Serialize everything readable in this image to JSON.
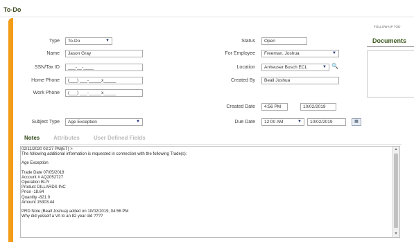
{
  "page": {
    "title": "To-Do"
  },
  "form": {
    "type": {
      "label": "Type",
      "value": "To-Do"
    },
    "name": {
      "label": "Name",
      "value": "Jason Gray"
    },
    "ssn": {
      "label": "SSN/Tax ID",
      "value": "___-__-____"
    },
    "home_phone": {
      "label": "Home Phone",
      "value": "(___) ___-_____x_____"
    },
    "work_phone": {
      "label": "Work Phone",
      "value": "(___) ___-_____x_____"
    },
    "subject_type": {
      "label": "Subject Type",
      "value": "Age Exception"
    },
    "status": {
      "label": "Status",
      "value": "Open"
    },
    "for_employee": {
      "label": "For Employee",
      "value": "Freeman, Joshua"
    },
    "location": {
      "label": "Location",
      "value": "Anheuser Busch ECL"
    },
    "created_by": {
      "label": "Created By",
      "value": "Beall Joshua"
    },
    "created_date": {
      "label": "Created Date",
      "time": "4:56 PM",
      "date": "10/02/2019"
    },
    "due_date": {
      "label": "Due Date",
      "time": "12:00 AM",
      "date": "10/02/2019"
    }
  },
  "side": {
    "followup_label": "FOLLOW-UP TOD",
    "documents_title": "Documents"
  },
  "icons": {
    "dropdown": "▼",
    "lookup": "🔍",
    "calendar": "▦",
    "scroll_up": "▲",
    "scroll_down": "▼"
  },
  "tabs": [
    {
      "label": "Notes",
      "active": true
    },
    {
      "label": "Attributes",
      "active": false
    },
    {
      "label": "User Defined Fields",
      "active": false
    }
  ],
  "notes": {
    "lines": [
      "02/11/2020 03:27 PM(ET) >",
      "The following additional information is requested in connection with the following Trade(s):",
      "",
      "Age Exception",
      "",
      "Trade Date 07/05/2018",
      "Account #   AQ2052727",
      "Operation   BUY",
      "Product     DILLARDS INC",
      "Price       -18.64",
      "Quantity    -821.0",
      "Amount      15303.44",
      "",
      "PRD Note (Beall Joshua) added on 10/02/2019, 04:56 PM",
      "Why did yesself a VA to an 82 year old ????"
    ]
  }
}
